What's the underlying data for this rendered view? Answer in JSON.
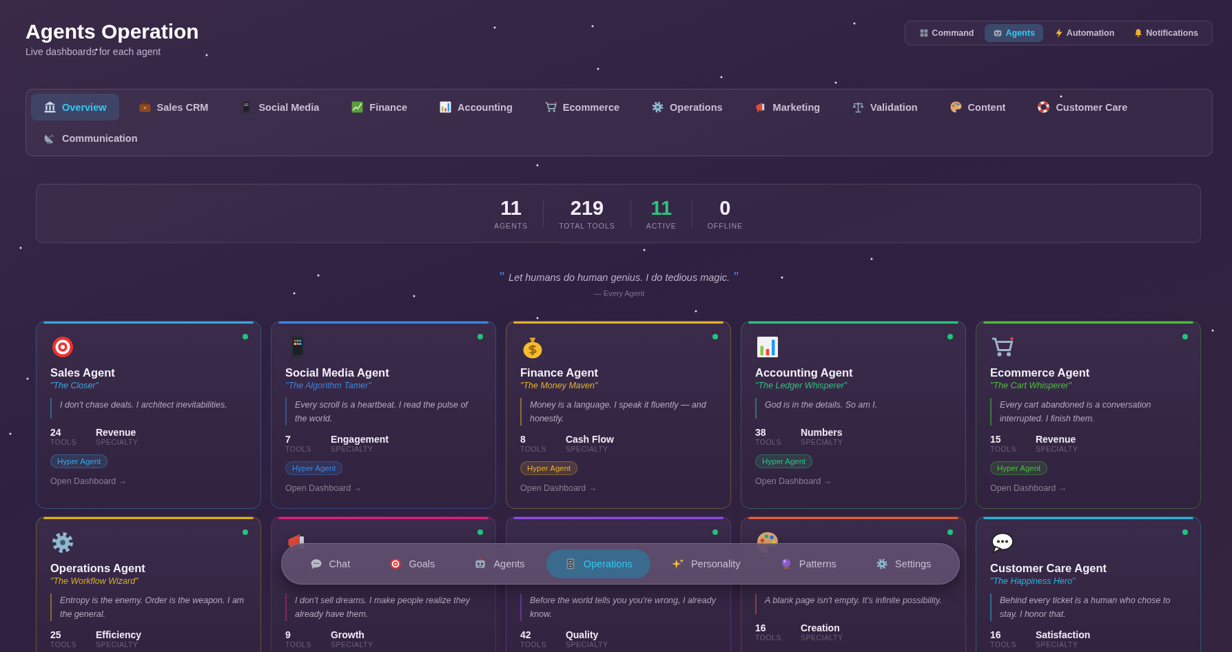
{
  "header": {
    "title": "Agents Operation",
    "subtitle": "Live dashboards for each agent"
  },
  "top_nav": [
    {
      "label": "Command",
      "selected": false
    },
    {
      "label": "Agents",
      "selected": true
    },
    {
      "label": "Automation",
      "selected": false
    },
    {
      "label": "Notifications",
      "selected": false
    }
  ],
  "tabs": [
    {
      "label": "Overview",
      "selected": true
    },
    {
      "label": "Sales CRM",
      "selected": false
    },
    {
      "label": "Social Media",
      "selected": false
    },
    {
      "label": "Finance",
      "selected": false
    },
    {
      "label": "Accounting",
      "selected": false
    },
    {
      "label": "Ecommerce",
      "selected": false
    },
    {
      "label": "Operations",
      "selected": false
    },
    {
      "label": "Marketing",
      "selected": false
    },
    {
      "label": "Validation",
      "selected": false
    },
    {
      "label": "Content",
      "selected": false
    },
    {
      "label": "Customer Care",
      "selected": false
    },
    {
      "label": "Communication",
      "selected": false
    }
  ],
  "stats": [
    {
      "value": "11",
      "label": "AGENTS",
      "color": "#f2eef8"
    },
    {
      "value": "219",
      "label": "TOTAL TOOLS",
      "color": "#f2eef8"
    },
    {
      "value": "11",
      "label": "ACTIVE",
      "color": "#2ec27e"
    },
    {
      "value": "0",
      "label": "OFFLINE",
      "color": "#f2eef8"
    }
  ],
  "motto": {
    "open_mark": "\"",
    "text": "Let humans do human genius. I do tedious magic.",
    "close_mark": "\"",
    "attribution": "— Every Agent"
  },
  "agents": [
    {
      "name": "Sales Agent",
      "nickname": "\"The Closer\"",
      "quote": "I don't chase deals. I architect inevitabilities.",
      "tools": "24",
      "tools_label": "TOOLS",
      "specialty": "Revenue",
      "specialty_label": "SPECIALTY",
      "badge": "Hyper Agent",
      "link": "Open Dashboard →",
      "online": true,
      "color": "#3aa6e0"
    },
    {
      "name": "Social Media Agent",
      "nickname": "\"The Algorithm Tamer\"",
      "quote": "Every scroll is a heartbeat. I read the pulse of the world.",
      "tools": "7",
      "tools_label": "TOOLS",
      "specialty": "Engagement",
      "specialty_label": "SPECIALTY",
      "badge": "Hyper Agent",
      "link": "Open Dashboard →",
      "online": true,
      "color": "#3a86e0"
    },
    {
      "name": "Finance Agent",
      "nickname": "\"The Money Maven\"",
      "quote": "Money is a language. I speak it fluently — and honestly.",
      "tools": "8",
      "tools_label": "TOOLS",
      "specialty": "Cash Flow",
      "specialty_label": "SPECIALTY",
      "badge": "Hyper Agent",
      "link": "Open Dashboard →",
      "online": true,
      "color": "#e3b12c"
    },
    {
      "name": "Accounting Agent",
      "nickname": "\"The Ledger Whisperer\"",
      "quote": "God is in the details. So am I.",
      "tools": "38",
      "tools_label": "TOOLS",
      "specialty": "Numbers",
      "specialty_label": "SPECIALTY",
      "badge": "Hyper Agent",
      "link": "Open Dashboard →",
      "online": true,
      "color": "#2ec27e"
    },
    {
      "name": "Ecommerce Agent",
      "nickname": "\"The Cart Whisperer\"",
      "quote": "Every cart abandoned is a conversation interrupted. I finish them.",
      "tools": "15",
      "tools_label": "TOOLS",
      "specialty": "Revenue",
      "specialty_label": "SPECIALTY",
      "badge": "Hyper Agent",
      "link": "Open Dashboard →",
      "online": true,
      "color": "#4cbf3c"
    },
    {
      "name": "Operations Agent",
      "nickname": "\"The Workflow Wizard\"",
      "quote": "Entropy is the enemy. Order is the weapon. I am the general.",
      "tools": "25",
      "tools_label": "TOOLS",
      "specialty": "Efficiency",
      "specialty_label": "SPECIALTY",
      "online": true,
      "color": "#d8b020"
    },
    {
      "quote": "I don't sell dreams. I make people realize they already have them.",
      "tools": "9",
      "tools_label": "TOOLS",
      "specialty": "Growth",
      "specialty_label": "SPECIALTY",
      "online": true,
      "color": "#e0207a"
    },
    {
      "quote": "Before the world tells you you're wrong, I already know.",
      "tools": "42",
      "tools_label": "TOOLS",
      "specialty": "Quality",
      "specialty_label": "SPECIALTY",
      "online": true,
      "color": "#8e4ae0"
    },
    {
      "quote": "A blank page isn't empty. It's infinite possibility.",
      "tools": "16",
      "tools_label": "TOOLS",
      "specialty": "Creation",
      "specialty_label": "SPECIALTY",
      "online": true,
      "color": "#e0603a"
    },
    {
      "name": "Customer Care Agent",
      "nickname": "\"The Happiness Hero\"",
      "quote": "Behind every ticket is a human who chose to stay. I honor that.",
      "tools": "16",
      "tools_label": "TOOLS",
      "specialty": "Satisfaction",
      "specialty_label": "SPECIALTY",
      "online": true,
      "color": "#22b8d8"
    }
  ],
  "dock": [
    {
      "label": "Chat",
      "selected": false
    },
    {
      "label": "Goals",
      "selected": false
    },
    {
      "label": "Agents",
      "selected": false
    },
    {
      "label": "Operations",
      "selected": true
    },
    {
      "label": "Personality",
      "selected": false
    },
    {
      "label": "Patterns",
      "selected": false
    },
    {
      "label": "Settings",
      "selected": false
    }
  ]
}
